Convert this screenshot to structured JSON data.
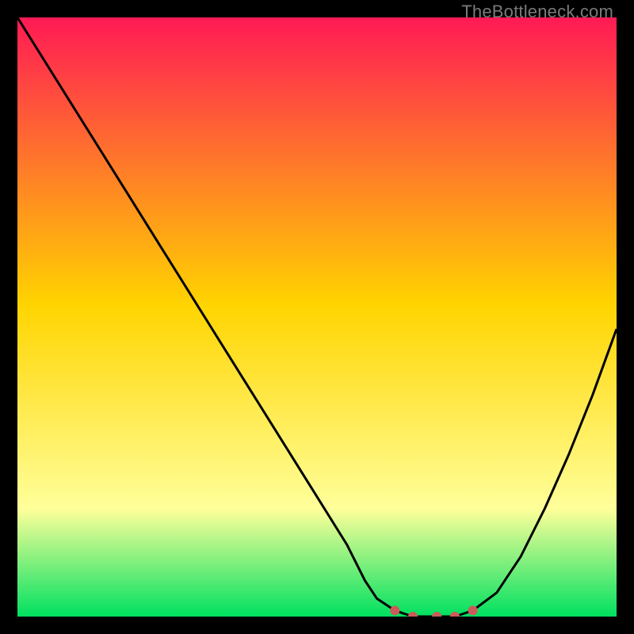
{
  "watermark": "TheBottleneck.com",
  "chart_data": {
    "type": "line",
    "title": "",
    "xlabel": "",
    "ylabel": "",
    "xlim": [
      0,
      100
    ],
    "ylim": [
      0,
      100
    ],
    "x": [
      0,
      5,
      10,
      15,
      20,
      25,
      30,
      35,
      40,
      45,
      50,
      55,
      58,
      60,
      63,
      66,
      70,
      73,
      76,
      80,
      84,
      88,
      92,
      96,
      100
    ],
    "values": [
      100,
      92,
      84,
      76,
      68,
      60,
      52,
      44,
      36,
      28,
      20,
      12,
      6,
      3,
      1,
      0,
      0,
      0,
      1,
      4,
      10,
      18,
      27,
      37,
      48
    ],
    "optimal_band": {
      "from": 58,
      "to": 78,
      "threshold": 2
    },
    "gradient_top": "#ff1a55",
    "gradient_mid": "#ffd400",
    "gradient_low": "#ffff9a",
    "gradient_bottom": "#00e060"
  }
}
